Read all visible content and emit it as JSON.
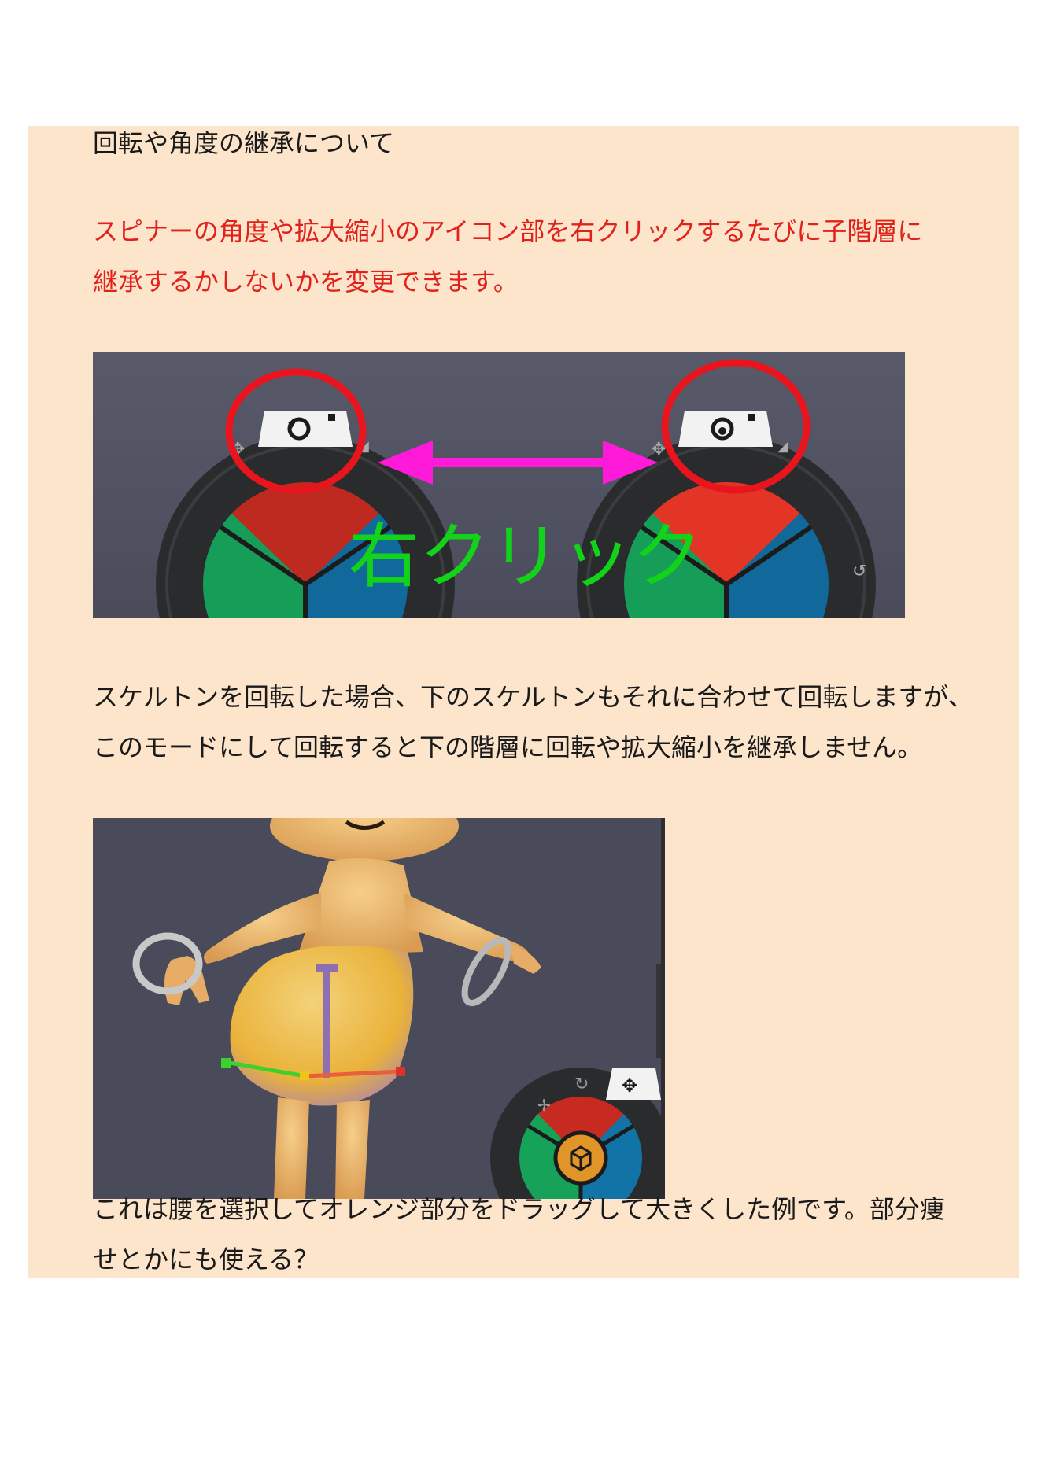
{
  "heading": "回転や角度の継承について",
  "highlight": {
    "line1": "スピナーの角度や拡大縮小のアイコン部を右クリックするたびに子階層に",
    "line2": "継承するかしないかを変更できます。"
  },
  "figure1": {
    "overlay_label": "右クリック"
  },
  "paragraph2": {
    "line1": "スケルトンを回転した場合、下のスケルトンもそれに合わせて回転しますが、",
    "line2": "このモードにして回転すると下の階層に回転や拡大縮小を継承しません。"
  },
  "paragraph3": {
    "line1": "これは腰を選択してオレンジ部分をドラッグして大きくした例です。部分痩",
    "line2": "せとかにも使える？"
  },
  "colors": {
    "panel_bg": "#fde5cc",
    "highlight_text": "#e0221b",
    "circle_red": "#e8141e",
    "arrow_magenta": "#ff1ad9",
    "label_green": "#12d21a",
    "spinner_red": "#c62a21",
    "spinner_green": "#17a259",
    "spinner_blue": "#1273a6",
    "viewport_bg": "#4c4c5e"
  },
  "icons": [
    "rotate-icon",
    "move-icon",
    "scale-icon",
    "cube-icon"
  ]
}
